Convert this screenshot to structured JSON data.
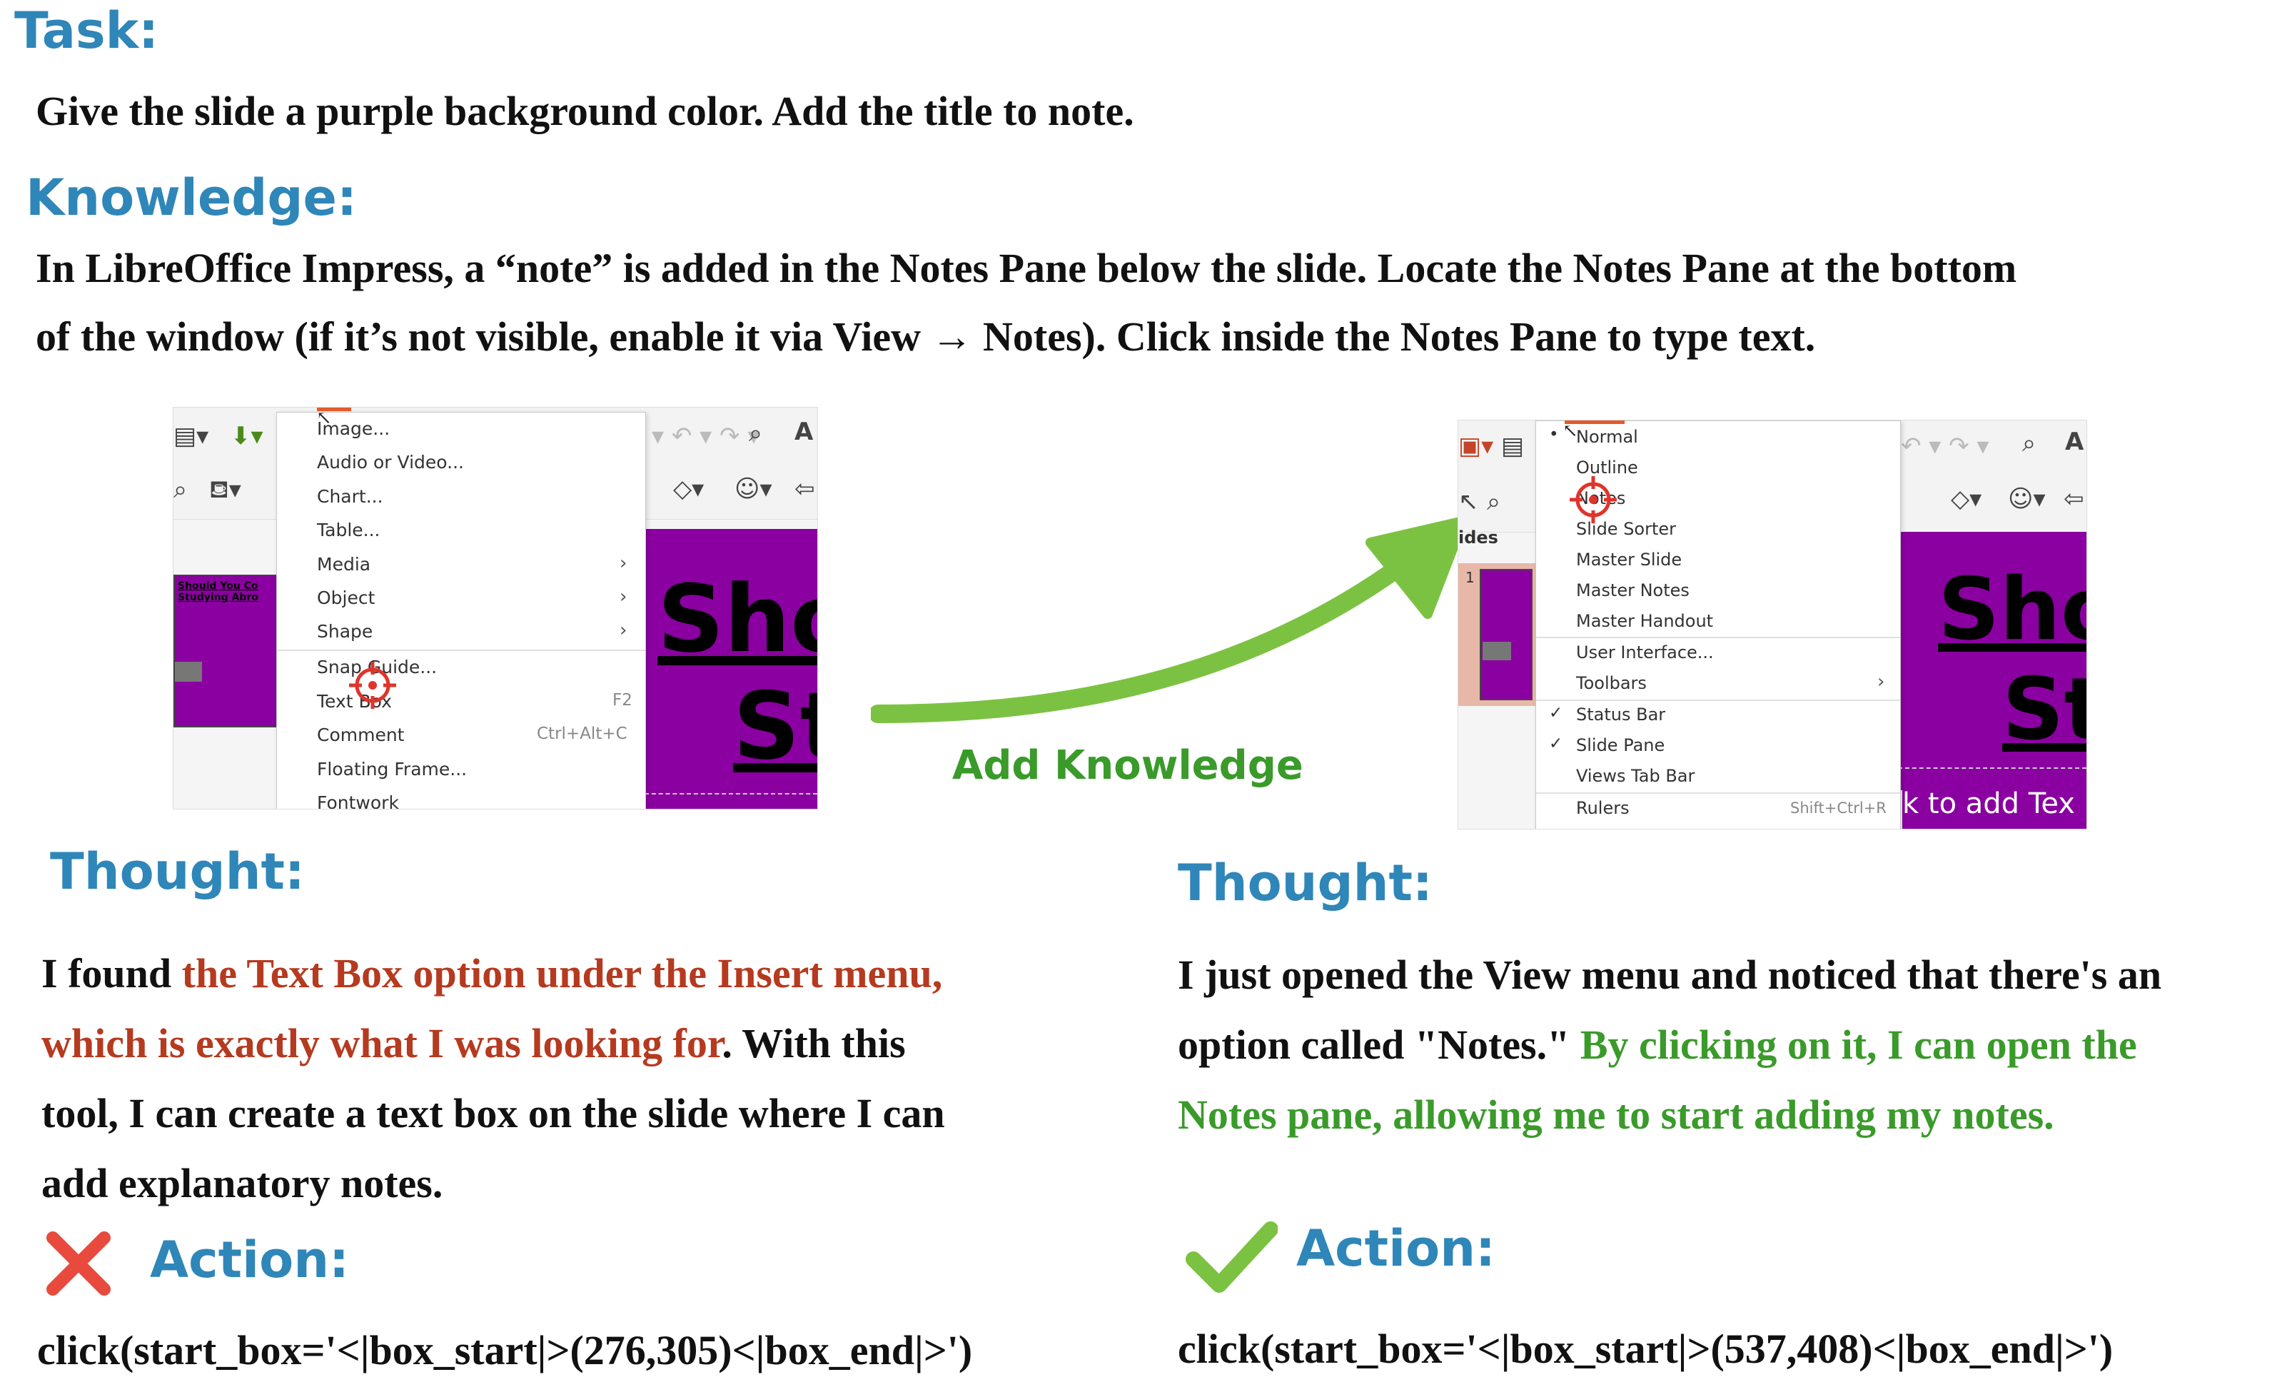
{
  "task": {
    "heading": "Task:",
    "text": "Give the slide a purple background color. Add the title to note."
  },
  "knowledge": {
    "heading": "Knowledge:",
    "line1": "In LibreOffice Impress, a “note” is added in the Notes Pane below the slide. Locate the Notes Pane at the bottom",
    "line2": "of the window (if it’s not visible, enable it via View → Notes). Click inside the Notes Pane to type text."
  },
  "arrow_label": "Add Knowledge",
  "colors": {
    "heading_blue": "#2f86b8",
    "wrong_red": "#b53a1f",
    "right_green": "#3a9a2a",
    "arrow_green": "#7cc242",
    "slide_purple": "#8a00a0",
    "target_red": "#e0342b"
  },
  "left_shot": {
    "menu_items": [
      {
        "label": "Image...",
        "accel": "",
        "submenu": false
      },
      {
        "label": "Audio or Video...",
        "accel": "",
        "submenu": false
      },
      {
        "label": "Chart...",
        "accel": "",
        "submenu": false
      },
      {
        "label": "Table...",
        "accel": "",
        "submenu": false
      },
      {
        "label": "Media",
        "accel": "",
        "submenu": true
      },
      {
        "label": "Object",
        "accel": "",
        "submenu": true
      },
      {
        "label": "Shape",
        "accel": "",
        "submenu": true
      },
      {
        "label": "Snap Guide...",
        "accel": "",
        "submenu": false
      },
      {
        "label": "Text Box",
        "accel": "F2",
        "submenu": false
      },
      {
        "label": "Comment",
        "accel": "Ctrl+Alt+C",
        "submenu": false
      },
      {
        "label": "Floating Frame...",
        "accel": "",
        "submenu": false
      },
      {
        "label": "Fontwork",
        "accel": "",
        "submenu": false
      }
    ],
    "slide_title_1": "Sho",
    "slide_title_2": "St",
    "thumb_text": "Should You Co Studying Abro"
  },
  "right_shot": {
    "pane_label": "ides",
    "slide_number": "1",
    "menu_items": [
      {
        "label": "Normal",
        "accel": "",
        "submenu": false,
        "mark": "•"
      },
      {
        "label": "Outline",
        "accel": "",
        "submenu": false,
        "mark": ""
      },
      {
        "label": "Notes",
        "accel": "",
        "submenu": false,
        "mark": ""
      },
      {
        "label": "Slide Sorter",
        "accel": "",
        "submenu": false,
        "mark": ""
      },
      {
        "label": "Master Slide",
        "accel": "",
        "submenu": false,
        "mark": ""
      },
      {
        "label": "Master Notes",
        "accel": "",
        "submenu": false,
        "mark": ""
      },
      {
        "label": "Master Handout",
        "accel": "",
        "submenu": false,
        "mark": ""
      },
      {
        "label": "User Interface...",
        "accel": "",
        "submenu": false,
        "mark": ""
      },
      {
        "label": "Toolbars",
        "accel": "",
        "submenu": true,
        "mark": ""
      },
      {
        "label": "Status Bar",
        "accel": "",
        "submenu": false,
        "mark": "✓"
      },
      {
        "label": "Slide Pane",
        "accel": "",
        "submenu": false,
        "mark": "✓"
      },
      {
        "label": "Views Tab Bar",
        "accel": "",
        "submenu": false,
        "mark": ""
      },
      {
        "label": "Rulers",
        "accel": "Shift+Ctrl+R",
        "submenu": false,
        "mark": ""
      }
    ],
    "slide_title_1": "Sho",
    "slide_title_2": "St",
    "notes_hint": "k to add Tex"
  },
  "left_thought": {
    "heading": "Thought:",
    "line1_a": "I found ",
    "line1_b": "the Text Box option under the Insert menu,",
    "line2_a": "which is exactly what I was looking for",
    "line2_b": ". With this",
    "line3": "tool, I can create a text box on the slide where I can",
    "line4": "add explanatory notes."
  },
  "right_thought": {
    "heading": "Thought:",
    "line1": "I just opened the View menu and noticed that there's an",
    "line2_a": "option called \"Notes.\" ",
    "line2_b": "By clicking on it, I can open the",
    "line3": "Notes pane, allowing me to start adding my notes."
  },
  "left_action": {
    "heading": "Action:",
    "code": "click(start_box='<|box_start|>(276,305)<|box_end|>')"
  },
  "right_action": {
    "heading": "Action:",
    "code": "click(start_box='<|box_start|>(537,408)<|box_end|>')"
  }
}
